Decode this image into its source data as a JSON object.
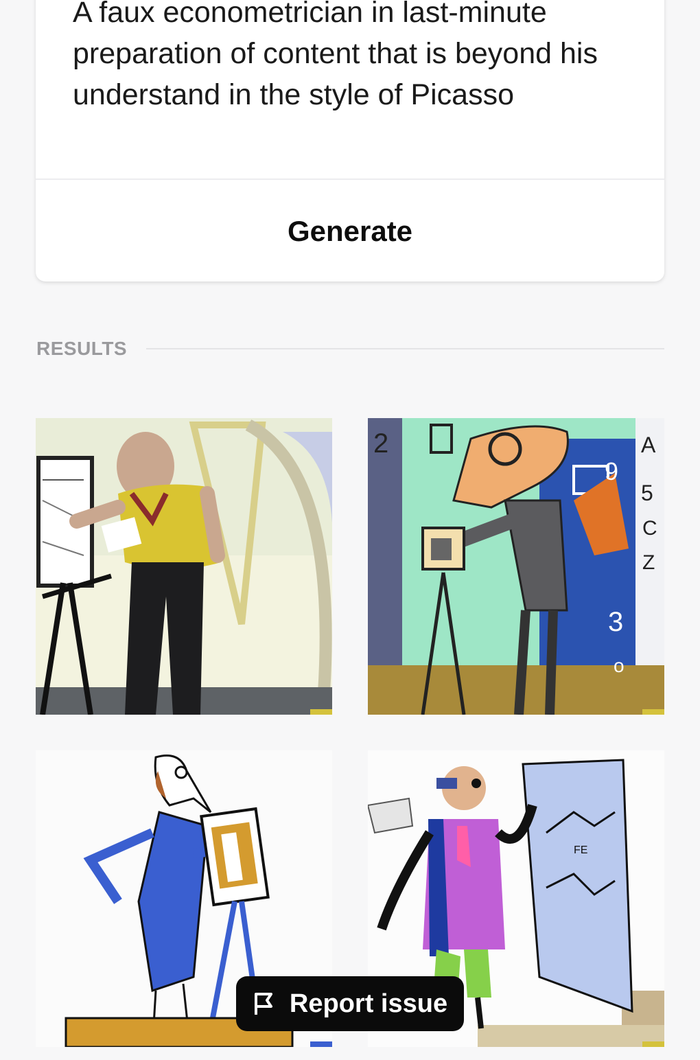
{
  "prompt": {
    "text": "A faux econometrician in last-minute preparation of content that is beyond his understand in the style of Picasso"
  },
  "generate_button": {
    "label": "Generate"
  },
  "results": {
    "label": "RESULTS",
    "images": [
      {
        "name": "result-image-1",
        "depicts": "realistic man in yellow shirt sketching at easel"
      },
      {
        "name": "result-image-2",
        "depicts": "cubist figure with glasses among numbers and letters"
      },
      {
        "name": "result-image-3",
        "depicts": "minimal line drawing of blue figure at easel"
      },
      {
        "name": "result-image-4",
        "depicts": "cartoon man with sunglasses drawing on blue chart"
      }
    ]
  },
  "report_button": {
    "label": "Report issue",
    "icon": "flag-icon"
  },
  "colors": {
    "background": "#f7f7f8",
    "card": "#ffffff",
    "results_label": "#9a9a9d",
    "report_bg": "#0b0b0b"
  }
}
